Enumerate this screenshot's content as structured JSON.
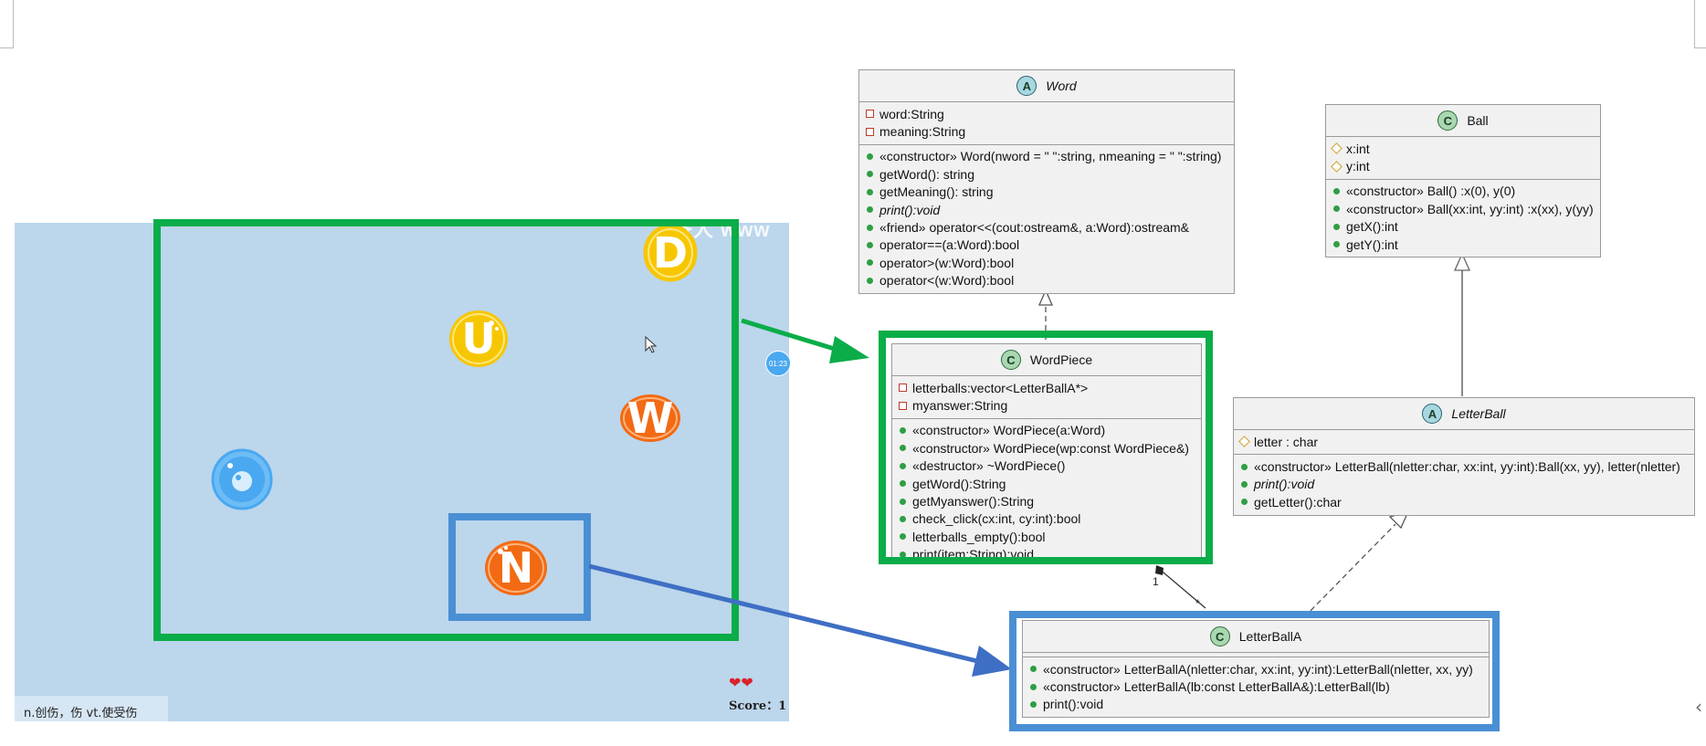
{
  "game": {
    "watermark": "济人 www",
    "timer": "01:23",
    "hint": "n.创伤，伤 vt.使受伤",
    "score_label": "Score：",
    "score_value": "1",
    "lives": "❤❤",
    "balls": [
      {
        "name": "ball-letter-d",
        "letter": "D",
        "color": "#f6c700"
      },
      {
        "name": "ball-letter-u",
        "letter": "U",
        "color": "#f6c700"
      },
      {
        "name": "ball-letter-w",
        "letter": "W",
        "color": "#f26a14"
      },
      {
        "name": "ball-letter-o",
        "letter": "",
        "color": "#4aa8f0"
      },
      {
        "name": "ball-letter-n",
        "letter": "N",
        "color": "#f26a14"
      }
    ]
  },
  "colors": {
    "green_frame": "#0aad48",
    "blue_frame": "#4a8fd4",
    "arrow_green": "#0aad48",
    "arrow_blue": "#3f6fc4"
  },
  "uml": {
    "word": {
      "badge": "A",
      "name": "Word",
      "fields": [
        {
          "vis": "private",
          "text": "word:String"
        },
        {
          "vis": "private",
          "text": "meaning:String"
        }
      ],
      "methods": [
        {
          "text": "«constructor» Word(nword = \" \":string, nmeaning = \" \":string)"
        },
        {
          "text": "getWord(): string"
        },
        {
          "text": "getMeaning(): string"
        },
        {
          "text": "print():void",
          "italic": true
        },
        {
          "text": "«friend» operator<<(cout:ostream&, a:Word):ostream&"
        },
        {
          "text": "operator==(a:Word):bool"
        },
        {
          "text": "operator>(w:Word):bool"
        },
        {
          "text": "operator<(w:Word):bool"
        }
      ]
    },
    "ball": {
      "badge": "C",
      "name": "Ball",
      "fields": [
        {
          "vis": "protected",
          "text": "x:int"
        },
        {
          "vis": "protected",
          "text": "y:int"
        }
      ],
      "methods": [
        {
          "text": "«constructor» Ball() :x(0), y(0)"
        },
        {
          "text": "«constructor» Ball(xx:int, yy:int) :x(xx), y(yy)"
        },
        {
          "text": "getX():int"
        },
        {
          "text": "getY():int"
        }
      ]
    },
    "wordpiece": {
      "badge": "C",
      "name": "WordPiece",
      "fields": [
        {
          "vis": "private",
          "text": "letterballs:vector<LetterBallA*>"
        },
        {
          "vis": "private",
          "text": "myanswer:String"
        }
      ],
      "methods": [
        {
          "text": "«constructor» WordPiece(a:Word)"
        },
        {
          "text": "«constructor» WordPiece(wp:const WordPiece&)"
        },
        {
          "text": "«destructor» ~WordPiece()"
        },
        {
          "text": "getWord():String"
        },
        {
          "text": "getMyanswer():String"
        },
        {
          "text": "check_click(cx:int, cy:int):bool"
        },
        {
          "text": "letterballs_empty():bool"
        },
        {
          "text": "print(item:String):void"
        }
      ]
    },
    "letterball": {
      "badge": "A",
      "name": "LetterBall",
      "fields": [
        {
          "vis": "protected",
          "text": "letter : char"
        }
      ],
      "methods": [
        {
          "text": "«constructor» LetterBall(nletter:char, xx:int, yy:int):Ball(xx, yy), letter(nletter)"
        },
        {
          "text": "print():void",
          "italic": true
        },
        {
          "text": "getLetter():char"
        }
      ]
    },
    "letterballa": {
      "badge": "C",
      "name": "LetterBallA",
      "fields": [],
      "methods": [
        {
          "text": "«constructor» LetterBallA(nletter:char, xx:int, yy:int):LetterBall(nletter, xx, yy)"
        },
        {
          "text": "«constructor» LetterBallA(lb:const LetterBallA&):LetterBall(lb)"
        },
        {
          "text": "print():void"
        }
      ]
    },
    "assoc": {
      "mult_one": "1",
      "mult_many": "*"
    }
  }
}
